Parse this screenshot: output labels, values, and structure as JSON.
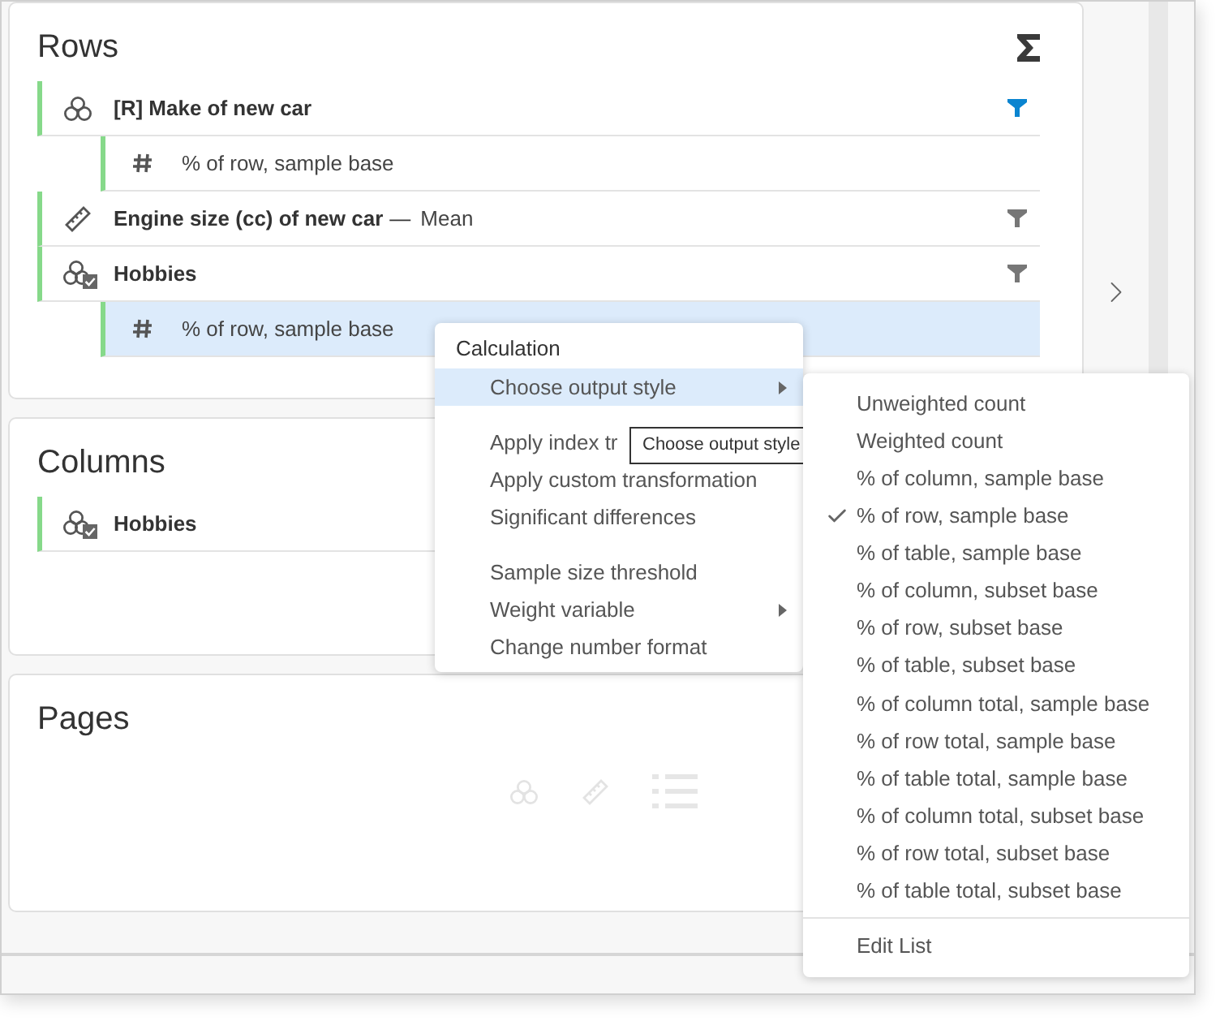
{
  "sections": [
    {
      "kind": "rows",
      "title": "Rows",
      "items": [
        {
          "label": "[R] Make of new car",
          "kind": "categorical",
          "filter_active": true,
          "children": [
            {
              "label": "% of row, sample base",
              "selected": false
            }
          ]
        },
        {
          "label": "Engine size (cc) of new car",
          "dash": "—",
          "statistic": "Mean",
          "kind": "numeric",
          "filter_active": false
        },
        {
          "label": "Hobbies",
          "kind": "multi",
          "filter_active": false,
          "children": [
            {
              "label": "% of row, sample base",
              "selected": true
            }
          ]
        }
      ]
    },
    {
      "kind": "columns",
      "title": "Columns",
      "items": [
        {
          "label": "Hobbies",
          "kind": "multi"
        }
      ]
    },
    {
      "kind": "pages",
      "title": "Pages"
    }
  ],
  "context_menu": {
    "header": "Calculation",
    "groups": [
      [
        {
          "label": "Choose output style",
          "selected": true,
          "has_submenu": true
        }
      ],
      [
        {
          "label": "Apply index tr",
          "selected": false,
          "has_submenu": false
        },
        {
          "label": "Apply custom transformation",
          "selected": false,
          "has_submenu": false
        },
        {
          "label": "Significant differences",
          "selected": false,
          "has_submenu": false
        }
      ],
      [
        {
          "label": "Sample size threshold",
          "selected": false,
          "has_submenu": false
        },
        {
          "label": "Weight variable",
          "selected": false,
          "has_submenu": true
        },
        {
          "label": "Change number format",
          "selected": false,
          "has_submenu": false
        }
      ]
    ]
  },
  "tooltip": "Choose output style",
  "submenu": {
    "items": [
      {
        "label": "Unweighted count",
        "checked": false
      },
      {
        "label": "Weighted count",
        "checked": false
      },
      {
        "label": "% of column, sample base",
        "checked": false
      },
      {
        "label": "% of row, sample base",
        "checked": true
      },
      {
        "label": "% of table, sample base",
        "checked": false
      },
      {
        "label": "% of column, subset base",
        "checked": false
      },
      {
        "label": "% of row, subset base",
        "checked": false
      },
      {
        "label": "% of table, subset base",
        "checked": false
      },
      {
        "label": "% of column total, sample base",
        "checked": false
      },
      {
        "label": "% of row total, sample base",
        "checked": false
      },
      {
        "label": "% of table total, sample base",
        "checked": false
      },
      {
        "label": "% of column total, subset base",
        "checked": false
      },
      {
        "label": "% of row total, subset base",
        "checked": false
      },
      {
        "label": "% of table total, subset base",
        "checked": false
      }
    ],
    "footer": "Edit List"
  }
}
